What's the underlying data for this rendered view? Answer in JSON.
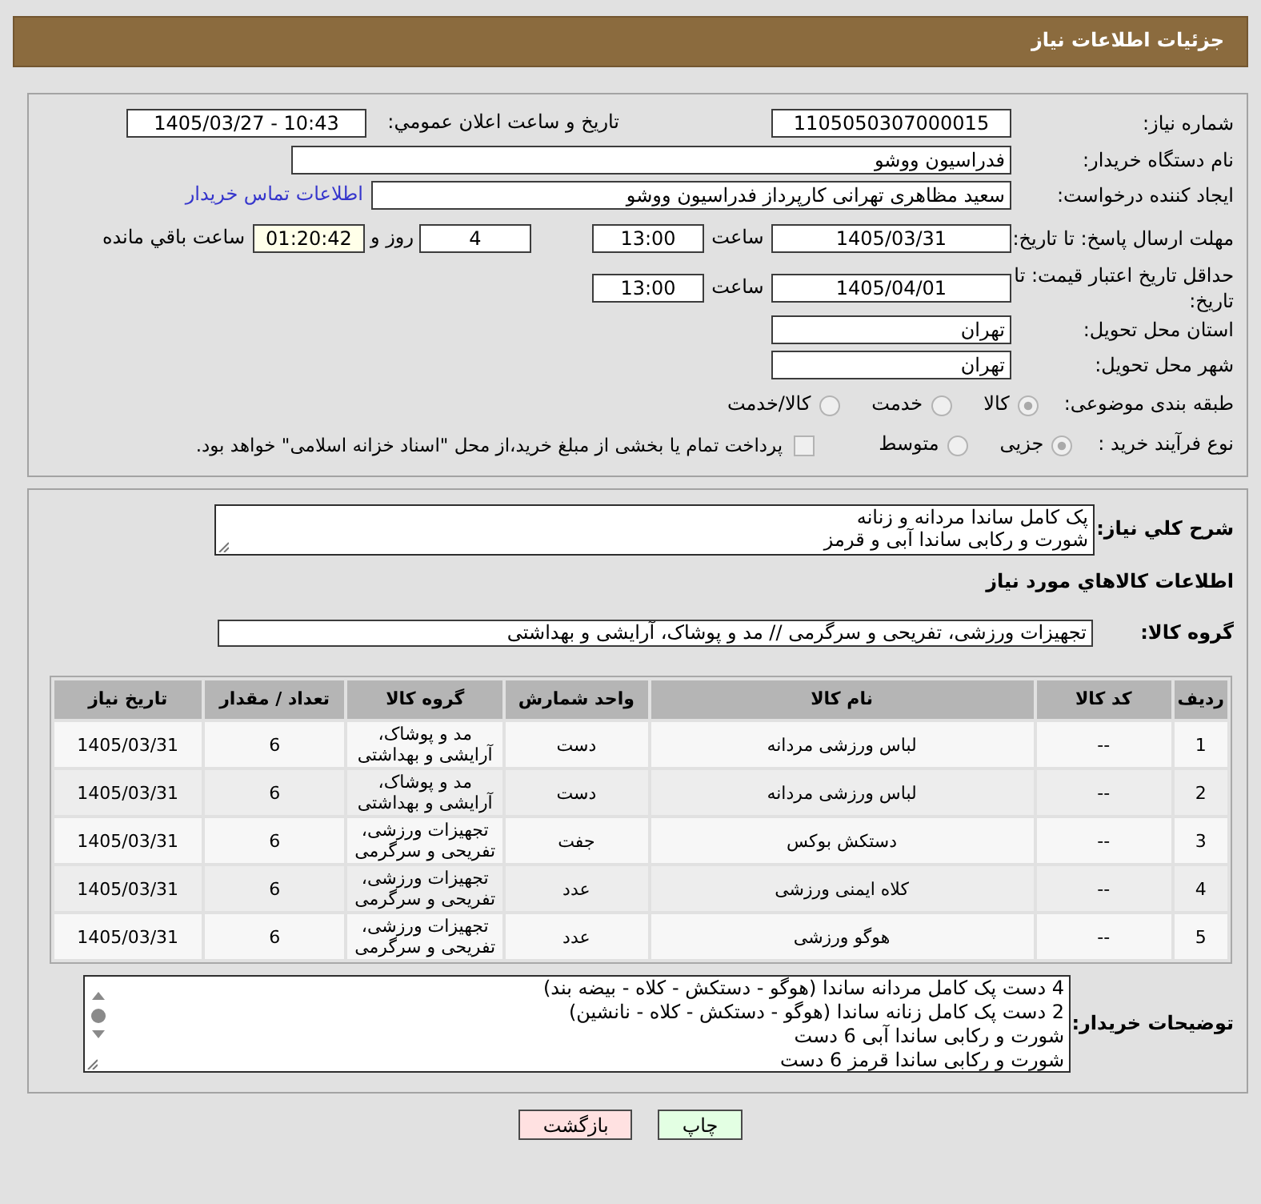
{
  "header": {
    "title": "جزئیات اطلاعات نیاز"
  },
  "details": {
    "need_number": {
      "label": "شماره نیاز:",
      "value": "1105050307000015"
    },
    "announce": {
      "label": "تاریخ و ساعت اعلان عمومي:",
      "value": "1405/03/27 - 10:43"
    },
    "buyer_org": {
      "label": "نام دستگاه خریدار:",
      "value": "فدراسیون ووشو"
    },
    "requester": {
      "label": "ایجاد کننده درخواست:",
      "value": "سعید مظاهری تهرانی کارپرداز فدراسیون ووشو",
      "contact_link": "اطلاعات تماس خریدار"
    },
    "response_deadline": {
      "label": "مهلت ارسال پاسخ: تا تاریخ:",
      "date": "1405/03/31",
      "time_label": "ساعت",
      "time": "13:00",
      "days": "4",
      "days_label": "روز و",
      "remaining": "01:20:42",
      "remaining_label": "ساعت باقي مانده"
    },
    "price_validity": {
      "label": "حداقل تاریخ اعتبار قیمت: تا تاریخ:",
      "date": "1405/04/01",
      "time_label": "ساعت",
      "time": "13:00"
    },
    "province": {
      "label": "استان محل تحویل:",
      "value": "تهران"
    },
    "city": {
      "label": "شهر محل تحویل:",
      "value": "تهران"
    },
    "category": {
      "label": "طبقه بندی موضوعی:",
      "options": [
        {
          "label": "کالا",
          "selected": true,
          "disabled": true
        },
        {
          "label": "خدمت",
          "selected": false,
          "disabled": true
        },
        {
          "label": "کالا/خدمت",
          "selected": false,
          "disabled": true
        }
      ]
    },
    "purchase_type": {
      "label": "نوع فرآیند خرید :",
      "options": [
        {
          "label": "جزیی",
          "selected": true,
          "disabled": true
        },
        {
          "label": "متوسط",
          "selected": false,
          "disabled": true
        }
      ],
      "treasury_payment": {
        "label": "پرداخت تمام یا بخشی از مبلغ خرید،از محل \"اسناد خزانه اسلامی\" خواهد بود.",
        "checked": false,
        "disabled": true
      }
    }
  },
  "needs": {
    "description": {
      "label": "شرح کلي نیاز:",
      "lines": [
        "پک کامل ساندا مردانه و زنانه",
        "شورت و رکابی ساندا آبی و قرمز"
      ]
    },
    "section_title": "اطلاعات کالاهاي مورد نیاز",
    "goods_group": {
      "label": "گروه کالا:",
      "value": "تجهیزات ورزشی، تفریحی و سرگرمی // مد و پوشاک، آرایشی و بهداشتی"
    },
    "table": {
      "columns": [
        "ردیف",
        "کد کالا",
        "نام کالا",
        "واحد شمارش",
        "گروه کالا",
        "تعداد / مقدار",
        "تاریخ نیاز"
      ],
      "rows": [
        [
          "1",
          "--",
          "لباس ورزشی مردانه",
          "دست",
          "مد و پوشاک، آرایشی و بهداشتی",
          "6",
          "1405/03/31"
        ],
        [
          "2",
          "--",
          "لباس ورزشی مردانه",
          "دست",
          "مد و پوشاک، آرایشی و بهداشتی",
          "6",
          "1405/03/31"
        ],
        [
          "3",
          "--",
          "دستکش بوکس",
          "جفت",
          "تجهیزات ورزشی، تفریحی و سرگرمی",
          "6",
          "1405/03/31"
        ],
        [
          "4",
          "--",
          "کلاه ایمنی ورزشی",
          "عدد",
          "تجهیزات ورزشی، تفریحی و سرگرمی",
          "6",
          "1405/03/31"
        ],
        [
          "5",
          "--",
          "هوگو ورزشی",
          "عدد",
          "تجهیزات ورزشی، تفریحی و سرگرمی",
          "6",
          "1405/03/31"
        ]
      ]
    },
    "buyer_notes": {
      "label": "توضیحات خریدار:",
      "lines": [
        "4 دست پک کامل مردانه ساندا (هوگو - دستکش - کلاه - بیضه بند)",
        "2 دست پک کامل زنانه ساندا (هوگو - دستکش - کلاه - نانشین)",
        "شورت و رکابی ساندا آبی 6 دست",
        "شورت و رکابی ساندا قرمز 6 دست"
      ]
    }
  },
  "buttons": [
    {
      "kind": "print",
      "label": "چاپ"
    },
    {
      "kind": "back",
      "label": "بازگشت"
    }
  ]
}
